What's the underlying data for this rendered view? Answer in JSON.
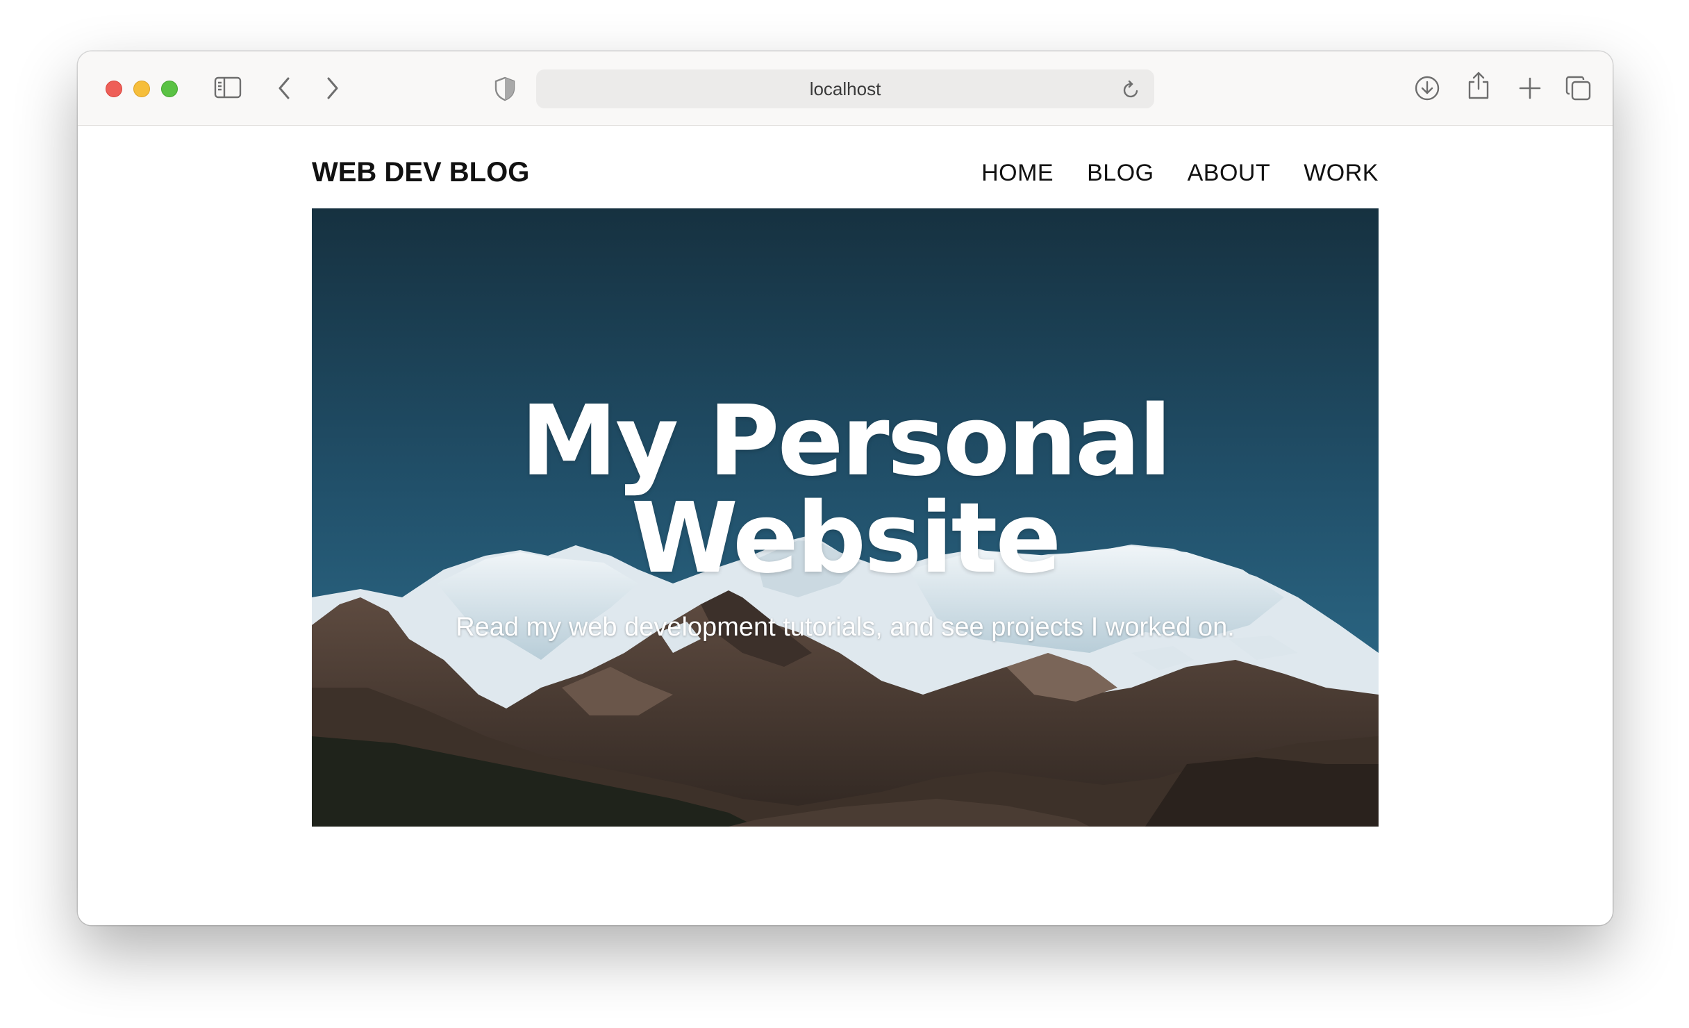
{
  "browser": {
    "url": "localhost",
    "icons": {
      "sidebar": "sidebar-icon",
      "back": "chevron-left-icon",
      "forward": "chevron-right-icon",
      "privacy": "shield-icon",
      "reload": "reload-icon",
      "downloads": "download-icon",
      "share": "share-icon",
      "new_tab": "plus-icon",
      "tabs": "tabs-overview-icon"
    }
  },
  "site": {
    "logo": "WEB DEV BLOG",
    "nav": [
      {
        "label": "HOME"
      },
      {
        "label": "BLOG"
      },
      {
        "label": "ABOUT"
      },
      {
        "label": "WORK"
      }
    ]
  },
  "hero": {
    "title_line1": "My Personal",
    "title_line2": "Website",
    "subtitle": "Read my web development tutorials, and see projects I worked on."
  },
  "colors": {
    "sky_top": "#173544",
    "sky_bottom": "#2b6a86",
    "snow": "#e6eef2",
    "rock": "#4d3c33",
    "forest": "#1a1d16",
    "text": "#111111"
  }
}
